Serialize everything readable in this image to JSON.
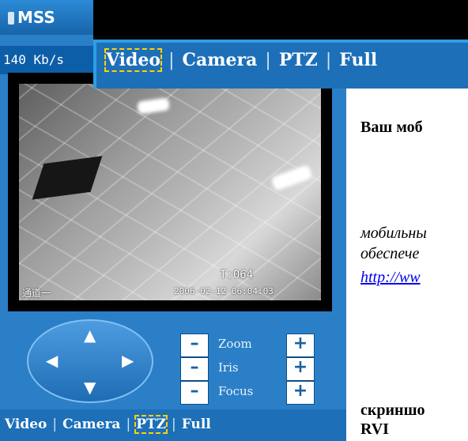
{
  "app": {
    "title": "MSS"
  },
  "status": {
    "bandwidth": "140 Kb/s"
  },
  "menu": {
    "items": [
      "Video",
      "Camera",
      "PTZ",
      "Full"
    ],
    "separator": "|"
  },
  "overlay_menu": {
    "selected": "Video"
  },
  "bottom_menu": {
    "selected": "PTZ"
  },
  "video": {
    "osd_time_label": "T:064",
    "channel_label": "通道一",
    "timestamp": "2006-02-12 06:04:03"
  },
  "ptz": {
    "controls": [
      {
        "label": "Zoom",
        "minus": "–",
        "plus": "+"
      },
      {
        "label": "Iris",
        "minus": "–",
        "plus": "+"
      },
      {
        "label": "Focus",
        "minus": "–",
        "plus": "+"
      }
    ],
    "arrows": {
      "up": "▲",
      "down": "▼",
      "left": "◀",
      "right": "▶"
    }
  },
  "document": {
    "heading": "Ваш моб",
    "italic_line_1": "мобильны",
    "italic_line_2": "обеспече",
    "link": "http://ww",
    "caption_line_1": "скриншо",
    "caption_line_2": "RVI"
  },
  "colors": {
    "brand_blue": "#1d6fb8",
    "selection": "#ffd200"
  }
}
